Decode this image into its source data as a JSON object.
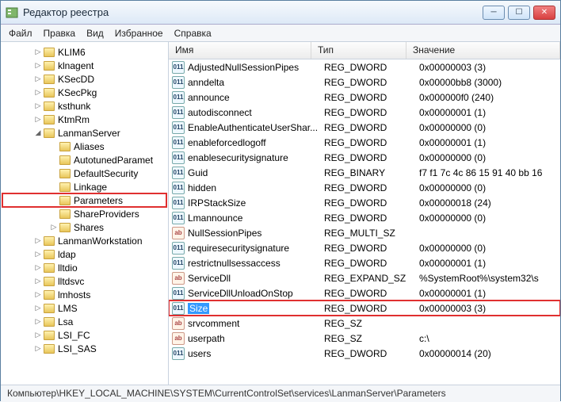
{
  "window": {
    "title": "Редактор реестра",
    "min": "─",
    "max": "☐",
    "close": "✕"
  },
  "menu": {
    "file": "Файл",
    "edit": "Правка",
    "view": "Вид",
    "favorites": "Избранное",
    "help": "Справка"
  },
  "columns": {
    "name": "Имя",
    "type": "Тип",
    "data": "Значение"
  },
  "tree": [
    {
      "label": "KLIM6",
      "indent": 1,
      "exp": "▷"
    },
    {
      "label": "klnagent",
      "indent": 1,
      "exp": "▷"
    },
    {
      "label": "KSecDD",
      "indent": 1,
      "exp": "▷"
    },
    {
      "label": "KSecPkg",
      "indent": 1,
      "exp": "▷"
    },
    {
      "label": "ksthunk",
      "indent": 1,
      "exp": "▷"
    },
    {
      "label": "KtmRm",
      "indent": 1,
      "exp": "▷"
    },
    {
      "label": "LanmanServer",
      "indent": 1,
      "exp": "◢"
    },
    {
      "label": "Aliases",
      "indent": 2,
      "exp": ""
    },
    {
      "label": "AutotunedParamet",
      "indent": 2,
      "exp": ""
    },
    {
      "label": "DefaultSecurity",
      "indent": 2,
      "exp": ""
    },
    {
      "label": "Linkage",
      "indent": 2,
      "exp": ""
    },
    {
      "label": "Parameters",
      "indent": 2,
      "exp": "",
      "hl": true
    },
    {
      "label": "ShareProviders",
      "indent": 2,
      "exp": ""
    },
    {
      "label": "Shares",
      "indent": 2,
      "exp": "▷"
    },
    {
      "label": "LanmanWorkstation",
      "indent": 1,
      "exp": "▷"
    },
    {
      "label": "ldap",
      "indent": 1,
      "exp": "▷"
    },
    {
      "label": "lltdio",
      "indent": 1,
      "exp": "▷"
    },
    {
      "label": "lltdsvc",
      "indent": 1,
      "exp": "▷"
    },
    {
      "label": "lmhosts",
      "indent": 1,
      "exp": "▷"
    },
    {
      "label": "LMS",
      "indent": 1,
      "exp": "▷"
    },
    {
      "label": "Lsa",
      "indent": 1,
      "exp": "▷"
    },
    {
      "label": "LSI_FC",
      "indent": 1,
      "exp": "▷"
    },
    {
      "label": "LSI_SAS",
      "indent": 1,
      "exp": "▷"
    }
  ],
  "values": [
    {
      "name": "AdjustedNullSessionPipes",
      "type": "REG_DWORD",
      "data": "0x00000003 (3)",
      "icon": "num"
    },
    {
      "name": "anndelta",
      "type": "REG_DWORD",
      "data": "0x00000bb8 (3000)",
      "icon": "num"
    },
    {
      "name": "announce",
      "type": "REG_DWORD",
      "data": "0x000000f0 (240)",
      "icon": "num"
    },
    {
      "name": "autodisconnect",
      "type": "REG_DWORD",
      "data": "0x00000001 (1)",
      "icon": "num"
    },
    {
      "name": "EnableAuthenticateUserShar...",
      "type": "REG_DWORD",
      "data": "0x00000000 (0)",
      "icon": "num"
    },
    {
      "name": "enableforcedlogoff",
      "type": "REG_DWORD",
      "data": "0x00000001 (1)",
      "icon": "num"
    },
    {
      "name": "enablesecuritysignature",
      "type": "REG_DWORD",
      "data": "0x00000000 (0)",
      "icon": "num"
    },
    {
      "name": "Guid",
      "type": "REG_BINARY",
      "data": "f7 f1 7c 4c 86 15 91 40 bb 16",
      "icon": "num"
    },
    {
      "name": "hidden",
      "type": "REG_DWORD",
      "data": "0x00000000 (0)",
      "icon": "num"
    },
    {
      "name": "IRPStackSize",
      "type": "REG_DWORD",
      "data": "0x00000018 (24)",
      "icon": "num"
    },
    {
      "name": "Lmannounce",
      "type": "REG_DWORD",
      "data": "0x00000000 (0)",
      "icon": "num"
    },
    {
      "name": "NullSessionPipes",
      "type": "REG_MULTI_SZ",
      "data": "",
      "icon": "str"
    },
    {
      "name": "requiresecuritysignature",
      "type": "REG_DWORD",
      "data": "0x00000000 (0)",
      "icon": "num"
    },
    {
      "name": "restrictnullsessaccess",
      "type": "REG_DWORD",
      "data": "0x00000001 (1)",
      "icon": "num"
    },
    {
      "name": "ServiceDll",
      "type": "REG_EXPAND_SZ",
      "data": "%SystemRoot%\\system32\\s",
      "icon": "str"
    },
    {
      "name": "ServiceDllUnloadOnStop",
      "type": "REG_DWORD",
      "data": "0x00000001 (1)",
      "icon": "num"
    },
    {
      "name": "Size",
      "type": "REG_DWORD",
      "data": "0x00000003 (3)",
      "icon": "num",
      "selected": true,
      "hl": true
    },
    {
      "name": "srvcomment",
      "type": "REG_SZ",
      "data": "",
      "icon": "str"
    },
    {
      "name": "userpath",
      "type": "REG_SZ",
      "data": "c:\\",
      "icon": "str"
    },
    {
      "name": "users",
      "type": "REG_DWORD",
      "data": "0x00000014 (20)",
      "icon": "num"
    }
  ],
  "statusbar": "Компьютер\\HKEY_LOCAL_MACHINE\\SYSTEM\\CurrentControlSet\\services\\LanmanServer\\Parameters"
}
